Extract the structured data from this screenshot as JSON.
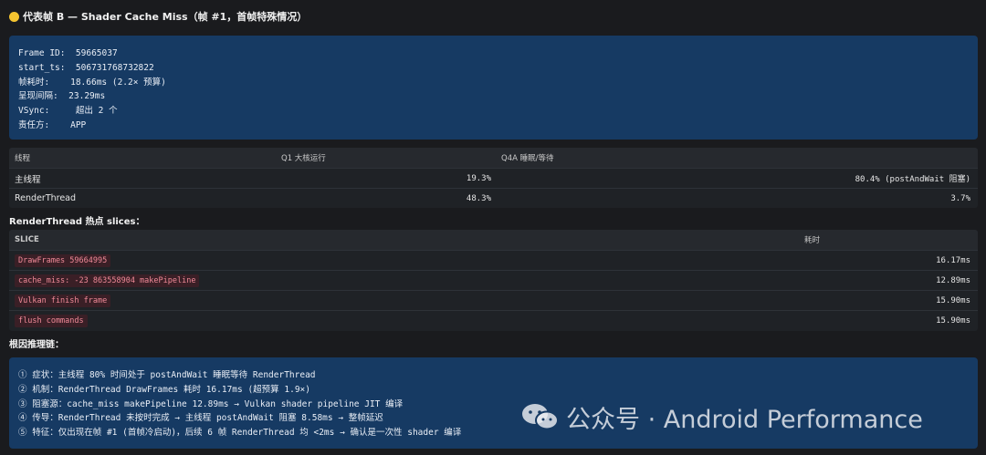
{
  "header": {
    "title": "代表帧 B — Shader Cache Miss（帧 #1，首帧特殊情况）",
    "dot_color": "#f4c430"
  },
  "frame_info": {
    "lines": [
      "Frame ID:  59665037",
      "start_ts:  506731768732822",
      "帧耗时:    18.66ms (2.2× 预算)",
      "呈现间隔:  23.29ms",
      "VSync:     超出 2 个",
      "责任方:    APP"
    ]
  },
  "threads": {
    "headers": [
      "线程",
      "Q1 大核运行",
      "Q4A 睡眠/等待"
    ],
    "rows": [
      {
        "name": "主线程",
        "q1": "19.3%",
        "q4a": "80.4% (postAndWait 阻塞)"
      },
      {
        "name": "RenderThread",
        "q1": "48.3%",
        "q4a": "3.7%"
      }
    ]
  },
  "slices_section": {
    "title": "RenderThread 热点 slices："
  },
  "slices": {
    "headers": [
      "SLICE",
      "耗时"
    ],
    "rows": [
      {
        "name": "DrawFrames 59664995",
        "dur": "16.17ms"
      },
      {
        "name": "cache_miss: -23 863558904 makePipeline",
        "dur": "12.89ms"
      },
      {
        "name": "Vulkan finish frame",
        "dur": "15.90ms"
      },
      {
        "name": "flush commands",
        "dur": "15.90ms"
      }
    ]
  },
  "chain_section": {
    "title": "根因推理链："
  },
  "chain": {
    "lines": [
      "① 症状：主线程 80% 时间处于 postAndWait 睡眠等待 RenderThread",
      "② 机制：RenderThread DrawFrames 耗时 16.17ms (超预算 1.9×)",
      "③ 阻塞源：cache_miss makePipeline 12.89ms → Vulkan shader pipeline JIT 编译",
      "④ 传导：RenderThread 未按时完成 → 主线程 postAndWait 阻塞 8.58ms → 整帧延迟",
      "⑤ 特征：仅出现在帧 #1 (首帧冷启动)，后续 6 帧 RenderThread 均 <2ms → 确认是一次性 shader 编译"
    ]
  },
  "watermark": {
    "text": "公众号 · Android Performance",
    "icon": "wechat-icon"
  }
}
